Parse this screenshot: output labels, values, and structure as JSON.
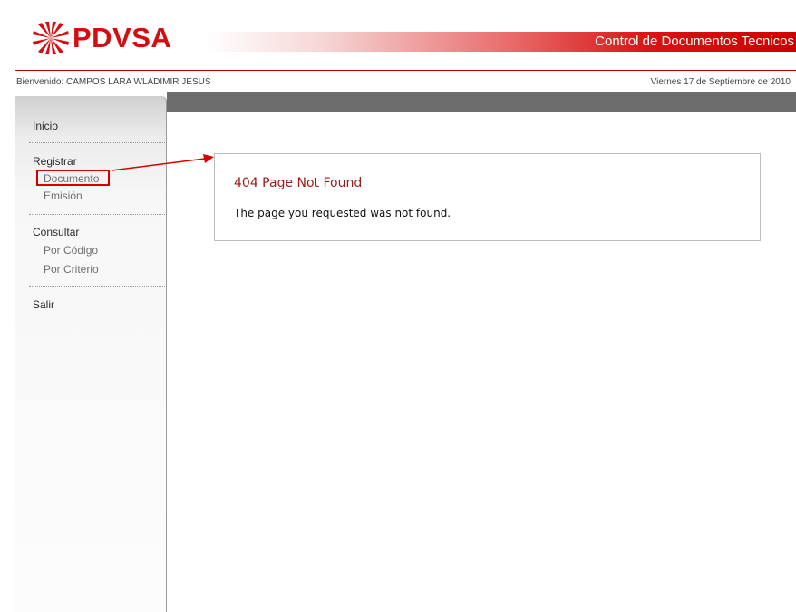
{
  "brand": {
    "name": "PDVSA",
    "color": "#d40d12"
  },
  "header": {
    "app_title": "Control de Documentos Tecnicos"
  },
  "user_bar": {
    "welcome": "Bienvenido: CAMPOS LARA WLADIMIR JESUS",
    "date": "Viernes 17 de Septiembre de 2010"
  },
  "sidebar": {
    "inicio": "Inicio",
    "registrar": {
      "label": "Registrar",
      "items": [
        "Documento",
        "Emisión"
      ]
    },
    "consultar": {
      "label": "Consultar",
      "items": [
        "Por Código",
        "Por Criterio"
      ]
    },
    "salir": "Salir"
  },
  "error": {
    "title": "404 Page Not Found",
    "message": "The page you requested was not found."
  },
  "annotation": {
    "highlight_color": "#d40000",
    "icon": "arrow-annotation-icon"
  }
}
